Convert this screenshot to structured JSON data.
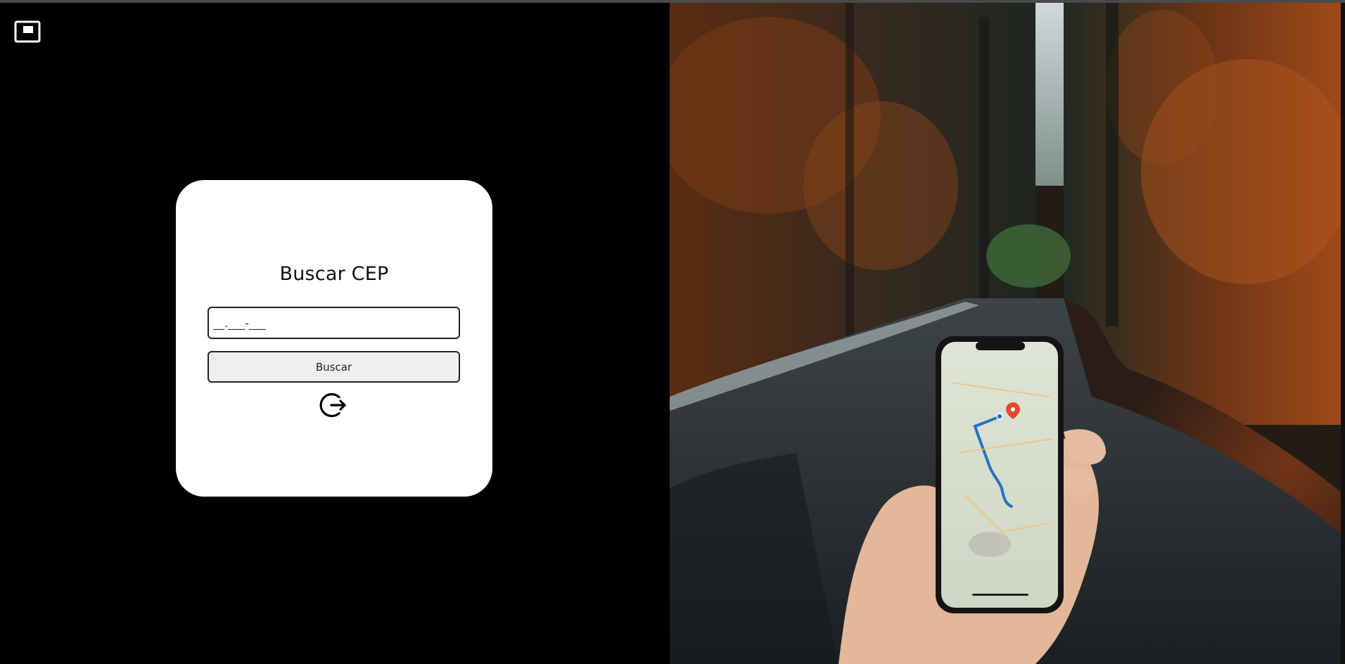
{
  "page": {
    "pip_icon": "picture-in-picture-icon"
  },
  "card": {
    "title": "Buscar CEP",
    "input": {
      "placeholder": "__.___-___",
      "value": ""
    },
    "button_label": "Buscar",
    "exit_icon": "logout-icon"
  },
  "hero_image": {
    "description_icon": "phone-map-forest-road-photo"
  },
  "colors": {
    "background_left": "#000000",
    "card": "#ffffff",
    "button": "#efefef",
    "border": "#222222"
  }
}
